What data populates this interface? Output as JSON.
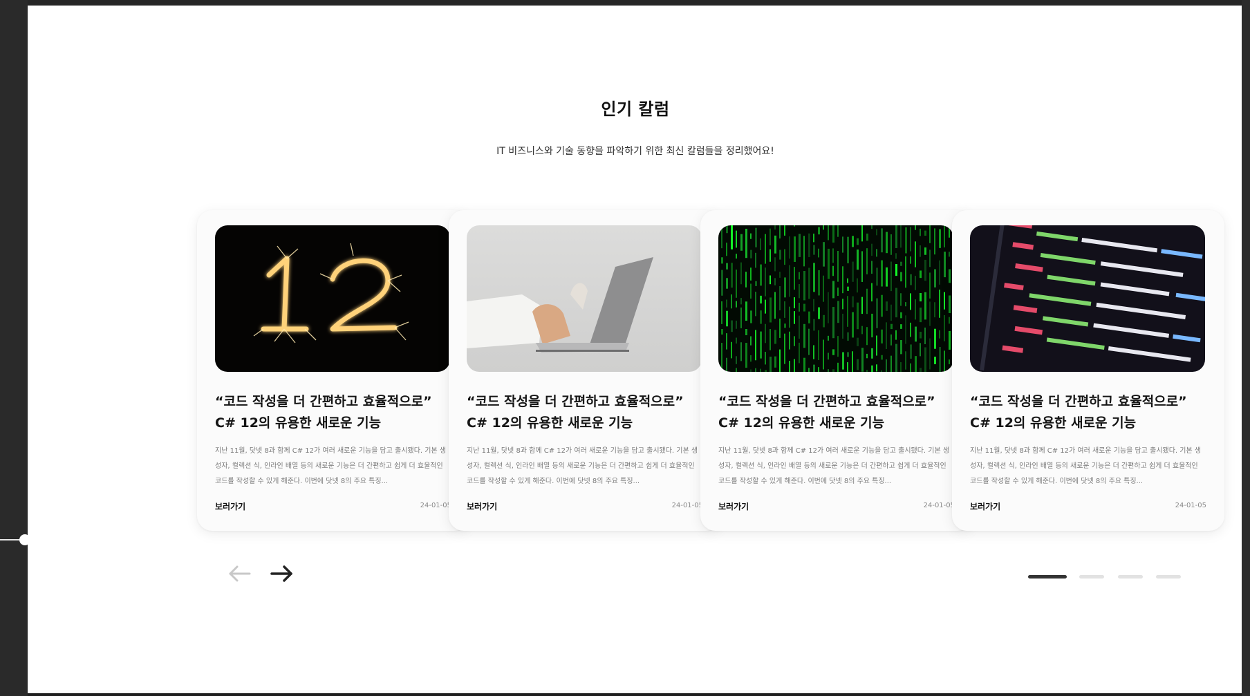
{
  "section": {
    "title": "인기 칼럼",
    "subtitle": "IT 비즈니스와 기술 동향을 파악하기 위한 최신 칼럼들을 정리했어요!"
  },
  "cards": [
    {
      "image": "sparkler-12",
      "title_line1": "“코드 작성을 더 간편하고 효율적으로”",
      "title_line2": "C# 12의 유용한 새로운 기능",
      "excerpt": "지난 11월, 닷넷 8과 함께 C# 12가 여러 새로운 기능을 담고 출시됐다. 기본 생성자, 컬렉션 식, 인라인 배열 등의 새로운 기능은 더 간편하고 쉽게 더 효율적인 코드를 작성할 수 있게 해준다. 이번에 닷넷 8의 주요 특징...",
      "link": "보러가기",
      "date": "24-01-05"
    },
    {
      "image": "laptop-hand",
      "title_line1": "“코드 작성을 더 간편하고 효율적으로”",
      "title_line2": "C# 12의 유용한 새로운 기능",
      "excerpt": "지난 11월, 닷넷 8과 함께 C# 12가 여러 새로운 기능을 담고 출시됐다. 기본 생성자, 컬렉션 식, 인라인 배열 등의 새로운 기능은 더 간편하고 쉽게 더 효율적인 코드를 작성할 수 있게 해준다. 이번에 닷넷 8의 주요 특징...",
      "link": "보러가기",
      "date": "24-01-05"
    },
    {
      "image": "green-matrix-code",
      "title_line1": "“코드 작성을 더 간편하고 효율적으로”",
      "title_line2": "C# 12의 유용한 새로운 기능",
      "excerpt": "지난 11월, 닷넷 8과 함께 C# 12가 여러 새로운 기능을 담고 출시됐다. 기본 생성자, 컬렉션 식, 인라인 배열 등의 새로운 기능은 더 간편하고 쉽게 더 효율적인 코드를 작성할 수 있게 해준다. 이번에 닷넷 8의 주요 특징...",
      "link": "보러가기",
      "date": "24-01-05"
    },
    {
      "image": "code-editor-screen",
      "title_line1": "“코드 작성을 더 간편하고 효율적으로”",
      "title_line2": "C# 12의 유용한 새로운 기능",
      "excerpt": "지난 11월, 닷넷 8과 함께 C# 12가 여러 새로운 기능을 담고 출시됐다. 기본 생성자, 컬렉션 식, 인라인 배열 등의 새로운 기능은 더 간편하고 쉽게 더 효율적인 코드를 작성할 수 있게 해준다. 이번에 닷넷 8의 주요 특징...",
      "link": "보러가기",
      "date": "24-01-05"
    }
  ],
  "controls": {
    "prev_icon": "arrow-left-icon",
    "next_icon": "arrow-right-icon",
    "active_page": 1,
    "page_count": 4
  },
  "colors": {
    "accent": "#333333",
    "inactive": "#e2e2e2",
    "card_bg": "#fbfbfb"
  }
}
